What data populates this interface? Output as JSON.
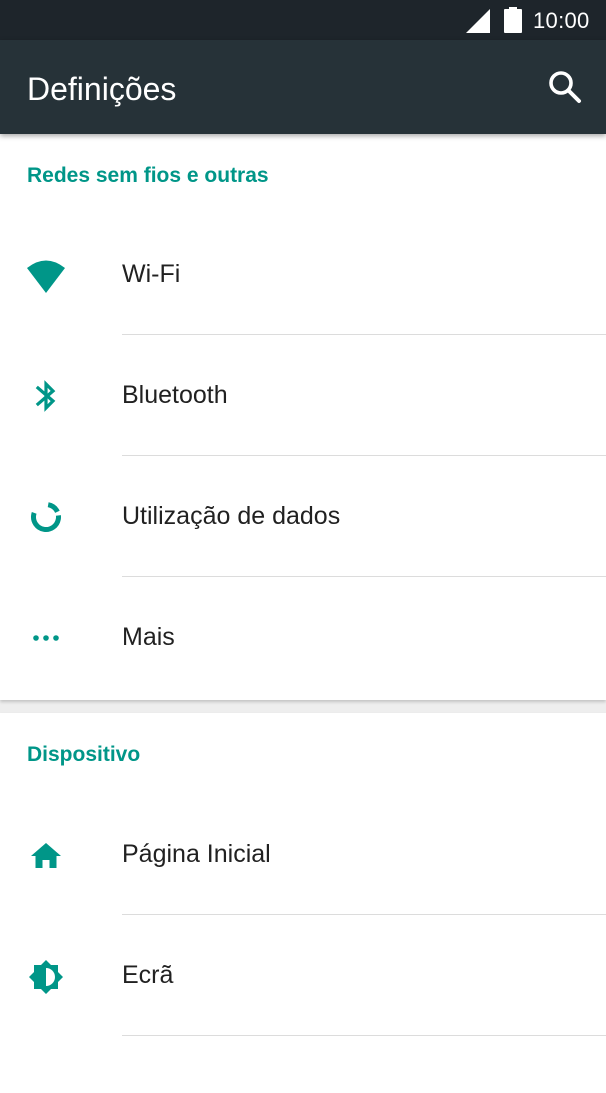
{
  "status_bar": {
    "time": "10:00",
    "icons": [
      "signal-icon",
      "battery-icon"
    ]
  },
  "app_bar": {
    "title": "Definições",
    "search_icon": "search-icon"
  },
  "sections": [
    {
      "title": "Redes sem fios e outras",
      "items": [
        {
          "label": "Wi-Fi",
          "icon": "wifi-icon"
        },
        {
          "label": "Bluetooth",
          "icon": "bluetooth-icon"
        },
        {
          "label": "Utilização de dados",
          "icon": "data-usage-icon"
        },
        {
          "label": "Mais",
          "icon": "more-icon"
        }
      ]
    },
    {
      "title": "Dispositivo",
      "items": [
        {
          "label": "Página Inicial",
          "icon": "home-icon"
        },
        {
          "label": "Ecrã",
          "icon": "display-icon"
        }
      ]
    }
  ],
  "colors": {
    "accent": "#009688",
    "status_bar": "#1e252b",
    "app_bar": "#263238",
    "background": "#eeeeee",
    "text": "#212121"
  }
}
